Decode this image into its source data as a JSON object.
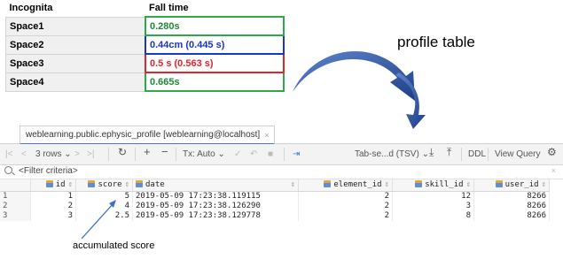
{
  "sheet": {
    "col_name": "Incognita",
    "col_value": "Fall time",
    "rows": [
      {
        "name": "Space1",
        "value": "0.280s",
        "color": "#2ea84a"
      },
      {
        "name": "Space2",
        "value": "0.44cm (0.445 s)",
        "color": "#1b35c8"
      },
      {
        "name": "Space3",
        "value": "0.5 s (0.563 s)",
        "color": "#e0262b"
      },
      {
        "name": "Space4",
        "value": "0.665s",
        "color": "#2ea84a"
      }
    ]
  },
  "callout": {
    "label": "profile table",
    "arrow_color": "#2f56a8"
  },
  "annotation": {
    "label": "accumulated score",
    "arrow_color": "#3a72c8"
  },
  "ide": {
    "tab": {
      "title": "weblearning.public.ephysic_profile [weblearning@localhost]",
      "close": "×"
    },
    "toolbar": {
      "first": "|<",
      "prev": "<",
      "rows": "3 rows ⌄",
      "next": ">",
      "last": ">|",
      "refresh": "↻",
      "add": "+",
      "remove": "−",
      "tx": "Tx: Auto ⌄",
      "commit": "✓",
      "rollback": "↶",
      "stop": "■",
      "pin": "⇥",
      "export_format": "Tab-se...d (TSV) ⌄",
      "download": "⤓",
      "upload": "⤒",
      "ddl": "DDL",
      "view_query": "View Query",
      "settings": "⚙"
    },
    "filter": {
      "placeholder": "<Filter criteria>",
      "clear": "×"
    },
    "columns": [
      "id",
      "score",
      "date",
      "element_id",
      "skill_id",
      "user_id"
    ],
    "rows": [
      {
        "n": "1",
        "id": "1",
        "score": "5",
        "date": "2019-05-09 17:23:38.119115",
        "element_id": "2",
        "skill_id": "12",
        "user_id": "8266"
      },
      {
        "n": "2",
        "id": "2",
        "score": "4",
        "date": "2019-05-09 17:23:38.126290",
        "element_id": "2",
        "skill_id": "3",
        "user_id": "8266"
      },
      {
        "n": "3",
        "id": "3",
        "score": "2.5",
        "date": "2019-05-09 17:23:38.129778",
        "element_id": "2",
        "skill_id": "8",
        "user_id": "8266"
      }
    ]
  }
}
